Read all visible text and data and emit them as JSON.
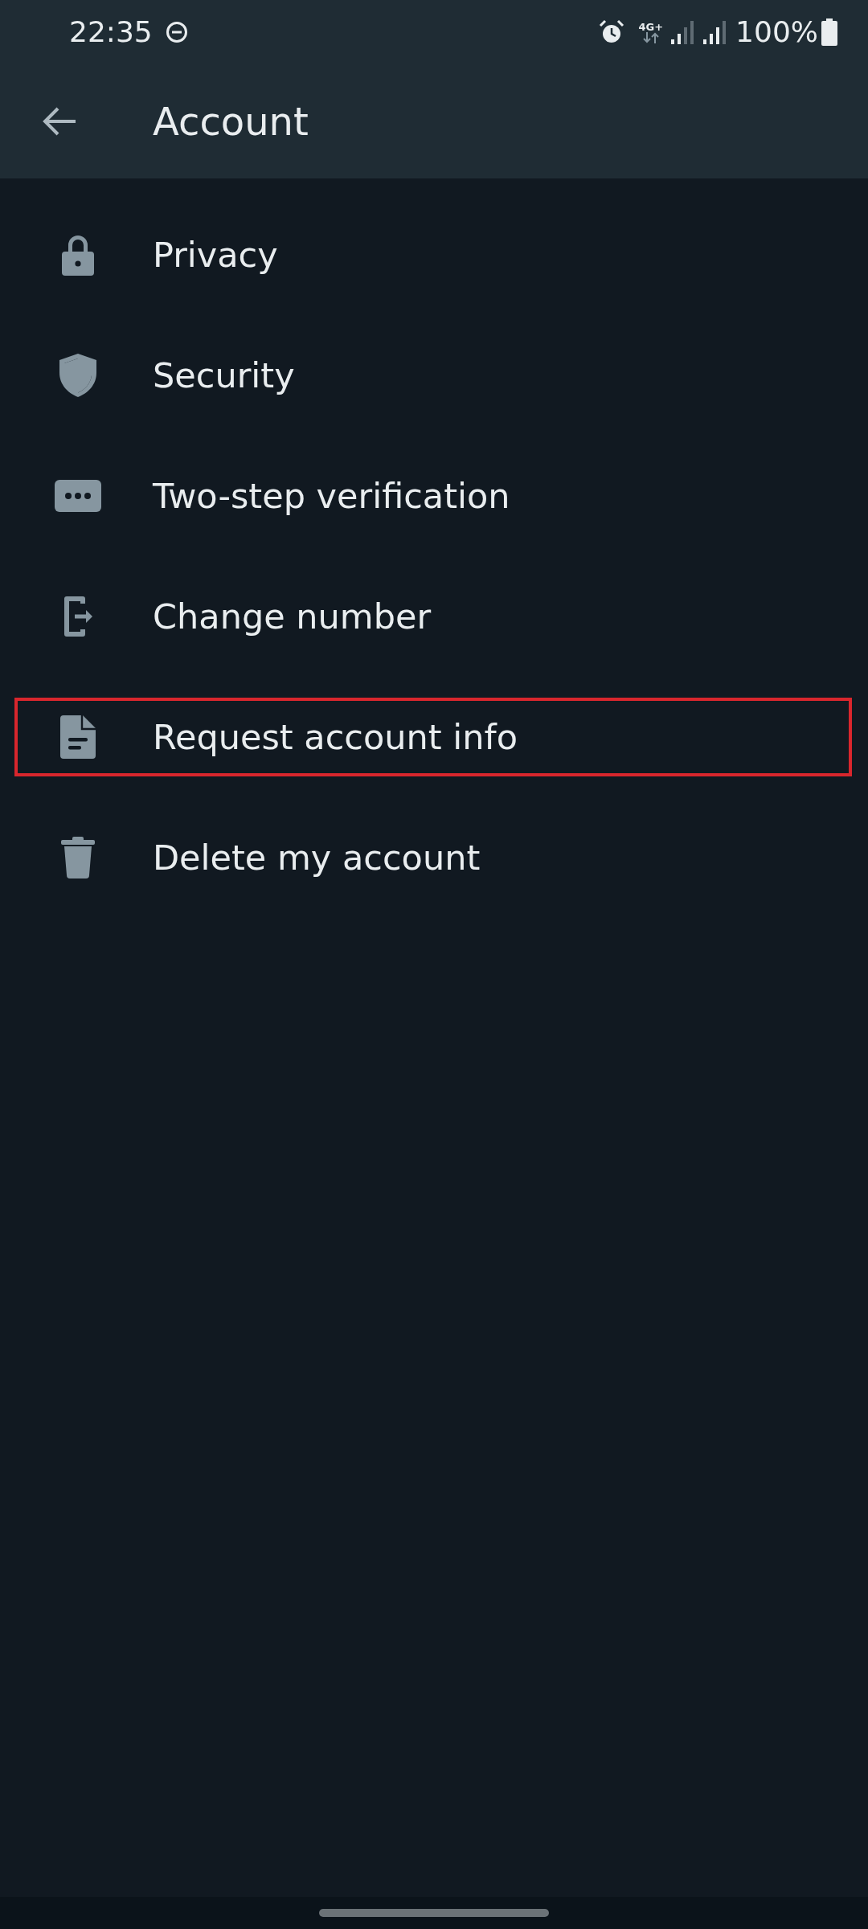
{
  "status_bar": {
    "time": "22:35",
    "network": "4G+",
    "battery": "100%"
  },
  "app_bar": {
    "title": "Account"
  },
  "items": [
    {
      "label": "Privacy",
      "kind": "lock",
      "selected": false
    },
    {
      "label": "Security",
      "kind": "shield",
      "selected": false
    },
    {
      "label": "Two-step verification",
      "kind": "dots",
      "selected": false
    },
    {
      "label": "Change number",
      "kind": "phone-exit",
      "selected": false
    },
    {
      "label": "Request account info",
      "kind": "document",
      "selected": true
    },
    {
      "label": "Delete my account",
      "kind": "trash",
      "selected": false
    }
  ]
}
